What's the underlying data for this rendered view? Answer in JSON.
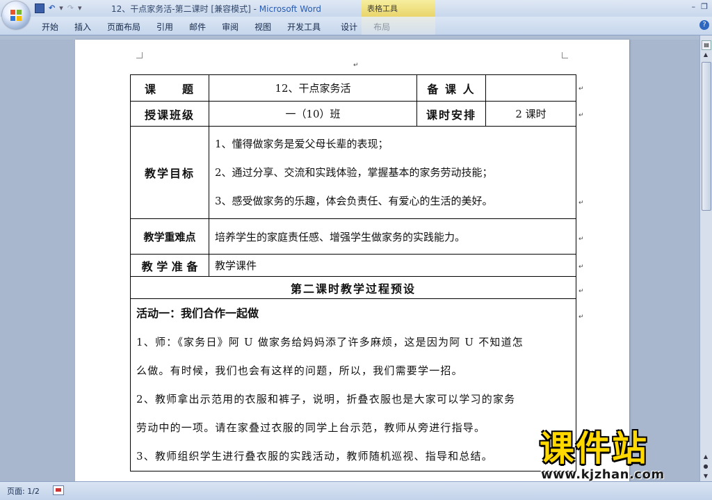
{
  "window": {
    "title": "12、干点家务活-第二课时 [兼容模式]",
    "app_name": "Microsoft Word",
    "context_group": "表格工具",
    "controls": [
      "–",
      "❐"
    ]
  },
  "ribbon": {
    "tabs": [
      "开始",
      "插入",
      "页面布局",
      "引用",
      "邮件",
      "审阅",
      "视图",
      "开发工具",
      "设计",
      "布局"
    ]
  },
  "qat": {
    "undo": "↶",
    "redo": "↷",
    "more": "▾"
  },
  "document": {
    "para_mark": "↵",
    "table": {
      "row1": {
        "label1": "课　　题",
        "value1": "12、干点家务活",
        "label2": "备 课 人",
        "value2": ""
      },
      "row2": {
        "label1": "授课班级",
        "value1": "一（10）班",
        "label2": "课时安排",
        "value2": "2 课时"
      },
      "row3": {
        "label": "教学目标",
        "lines": [
          "1、懂得做家务是爱父母长辈的表现；",
          "2、通过分享、交流和实践体验，掌握基本的家务劳动技能；",
          "3、感受做家务的乐趣，体会负责任、有爱心的生活的美好。"
        ]
      },
      "row4": {
        "label": "教学重难点",
        "value": "培养学生的家庭责任感、增强学生做家务的实践能力。"
      },
      "row5": {
        "label": "教 学 准 备",
        "value": "教学课件"
      },
      "row6": {
        "heading": "第二课时教学过程预设"
      },
      "row7": {
        "activity_title": "活动一：我们合作一起做",
        "lines": [
          "1、师：《家务日》阿 U 做家务给妈妈添了许多麻烦，这是因为阿 U 不知道怎",
          "么做。有时候，我们也会有这样的问题，所以，我们需要学一招。",
          "2、教师拿出示范用的衣服和裤子，说明，折叠衣服也是大家可以学习的家务",
          "劳动中的一项。请在家叠过衣服的同学上台示范，教师从旁进行指导。",
          "3、教师组织学生进行叠衣服的实践活动，教师随机巡视、指导和总结。"
        ]
      }
    }
  },
  "status": {
    "page": "页面: 1/2"
  },
  "watermark": {
    "brand": "课件站",
    "url": "www.kjzhan.com"
  }
}
